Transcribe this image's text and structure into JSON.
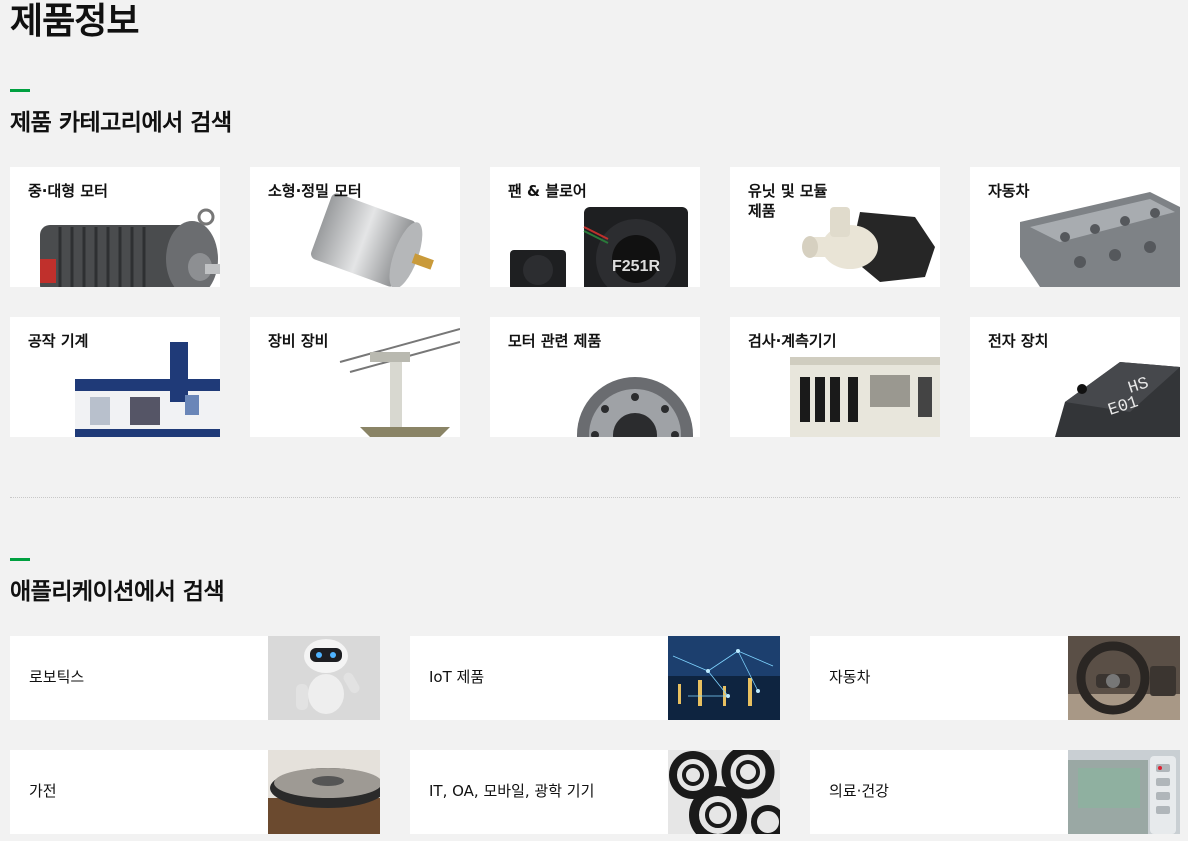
{
  "page": {
    "title": "제품정보"
  },
  "category_section": {
    "title": "제품 카테고리에서 검색",
    "items": [
      {
        "label": "중·대형 모터",
        "icon": "large-motor-icon"
      },
      {
        "label": "소형·정밀 모터",
        "icon": "small-motor-icon"
      },
      {
        "label": "팬 & 블로어",
        "icon": "fan-icon",
        "image_text": "F251R"
      },
      {
        "label": "유닛 및 모듈\n제품",
        "icon": "pump-unit-icon"
      },
      {
        "label": "자동차",
        "icon": "automotive-part-icon"
      },
      {
        "label": "공작 기계",
        "icon": "machine-tool-icon"
      },
      {
        "label": "장비 장비",
        "icon": "robot-arm-icon"
      },
      {
        "label": "모터 관련 제품",
        "icon": "reducer-gear-icon"
      },
      {
        "label": "검사·계측기기",
        "icon": "inspection-machine-icon"
      },
      {
        "label": "전자 장치",
        "icon": "electronic-component-icon",
        "image_text": "HS\nE01"
      }
    ]
  },
  "application_section": {
    "title": "애플리케이션에서 검색",
    "items": [
      {
        "label": "로보틱스",
        "icon": "robot-icon"
      },
      {
        "label": "IoT 제품",
        "icon": "iot-city-icon"
      },
      {
        "label": "자동차",
        "icon": "car-interior-icon"
      },
      {
        "label": "가전",
        "icon": "robot-vacuum-icon"
      },
      {
        "label": "IT, OA, 모바일, 광학 기기",
        "icon": "camera-lens-icon"
      },
      {
        "label": "의료·건강",
        "icon": "medical-device-icon"
      }
    ]
  },
  "colors": {
    "accent": "#00a040",
    "background": "#f2f2f2",
    "card": "#ffffff"
  }
}
